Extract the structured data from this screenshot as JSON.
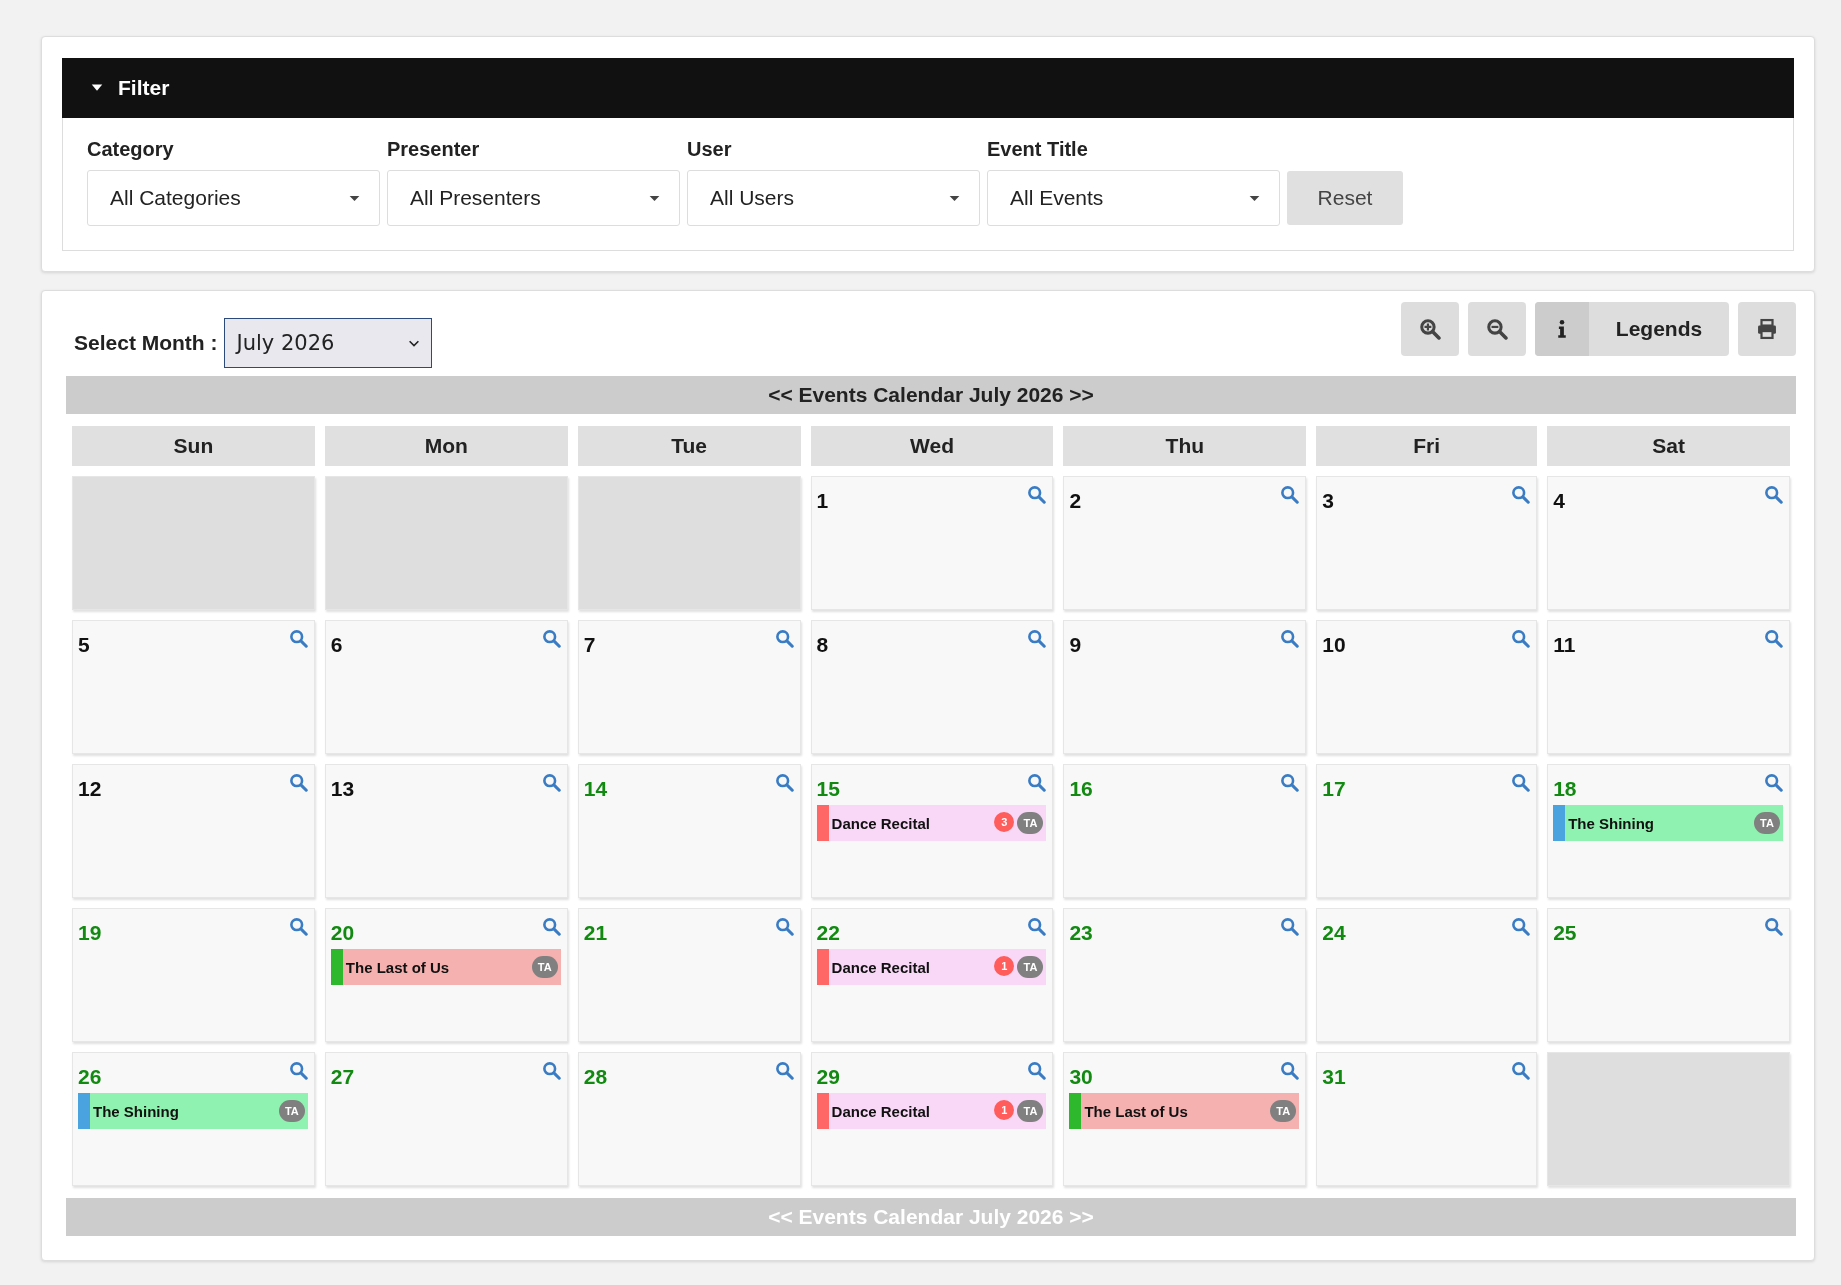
{
  "filter": {
    "title": "Filter",
    "expanded": true,
    "fields": [
      {
        "label": "Category",
        "value": "All Categories"
      },
      {
        "label": "Presenter",
        "value": "All Presenters"
      },
      {
        "label": "User",
        "value": "All Users"
      },
      {
        "label": "Event Title",
        "value": "All Events"
      }
    ],
    "reset": "Reset"
  },
  "calendar": {
    "month_label": "Select Month :",
    "month": "July 2026",
    "legends": "Legends",
    "header": "<< Events Calendar July 2026 >>",
    "footer": "<< Events Calendar July 2026 >>",
    "weekdays": [
      "Sun",
      "Mon",
      "Tue",
      "Wed",
      "Thu",
      "Fri",
      "Sat"
    ],
    "weeks": [
      [
        {
          "kind": "empty"
        },
        {
          "kind": "empty"
        },
        {
          "kind": "empty"
        },
        {
          "kind": "day",
          "day": "1",
          "upcoming": false
        },
        {
          "kind": "day",
          "day": "2",
          "upcoming": false
        },
        {
          "kind": "day",
          "day": "3",
          "upcoming": false
        },
        {
          "kind": "day",
          "day": "4",
          "upcoming": false
        }
      ],
      [
        {
          "kind": "day",
          "day": "5",
          "upcoming": false
        },
        {
          "kind": "day",
          "day": "6",
          "upcoming": false
        },
        {
          "kind": "day",
          "day": "7",
          "upcoming": false
        },
        {
          "kind": "day",
          "day": "8",
          "upcoming": false
        },
        {
          "kind": "day",
          "day": "9",
          "upcoming": false
        },
        {
          "kind": "day",
          "day": "10",
          "upcoming": false
        },
        {
          "kind": "day",
          "day": "11",
          "upcoming": false
        }
      ],
      [
        {
          "kind": "day",
          "day": "12",
          "upcoming": false
        },
        {
          "kind": "day",
          "day": "13",
          "upcoming": false
        },
        {
          "kind": "day",
          "day": "14",
          "upcoming": true
        },
        {
          "kind": "day",
          "day": "15",
          "upcoming": true,
          "events": [
            {
              "title": "Dance Recital",
              "color": "#ff6666",
              "kind": "pink",
              "count": "3",
              "initials": "TA"
            }
          ]
        },
        {
          "kind": "day",
          "day": "16",
          "upcoming": true
        },
        {
          "kind": "day",
          "day": "17",
          "upcoming": true
        },
        {
          "kind": "day",
          "day": "18",
          "upcoming": true,
          "events": [
            {
              "title": "The Shining",
              "color": "#4aa3df",
              "kind": "mint",
              "initials": "TA"
            }
          ]
        }
      ],
      [
        {
          "kind": "day",
          "day": "19",
          "upcoming": true
        },
        {
          "kind": "day",
          "day": "20",
          "upcoming": true,
          "events": [
            {
              "title": "The Last of Us",
              "color": "#2db82d",
              "kind": "salmon",
              "initials": "TA"
            }
          ]
        },
        {
          "kind": "day",
          "day": "21",
          "upcoming": true
        },
        {
          "kind": "day",
          "day": "22",
          "upcoming": true,
          "events": [
            {
              "title": "Dance Recital",
              "color": "#ff6666",
              "kind": "pink",
              "count": "1",
              "initials": "TA"
            }
          ]
        },
        {
          "kind": "day",
          "day": "23",
          "upcoming": true
        },
        {
          "kind": "day",
          "day": "24",
          "upcoming": true
        },
        {
          "kind": "day",
          "day": "25",
          "upcoming": true
        }
      ],
      [
        {
          "kind": "day",
          "day": "26",
          "upcoming": true,
          "events": [
            {
              "title": "The Shining",
              "color": "#4aa3df",
              "kind": "mint",
              "initials": "TA"
            }
          ]
        },
        {
          "kind": "day",
          "day": "27",
          "upcoming": true
        },
        {
          "kind": "day",
          "day": "28",
          "upcoming": true
        },
        {
          "kind": "day",
          "day": "29",
          "upcoming": true,
          "events": [
            {
              "title": "Dance Recital",
              "color": "#ff6666",
              "kind": "pink",
              "count": "1",
              "initials": "TA"
            }
          ]
        },
        {
          "kind": "day",
          "day": "30",
          "upcoming": true,
          "events": [
            {
              "title": "The Last of Us",
              "color": "#2db82d",
              "kind": "salmon",
              "initials": "TA"
            }
          ]
        },
        {
          "kind": "day",
          "day": "31",
          "upcoming": true
        },
        {
          "kind": "empty"
        }
      ]
    ]
  }
}
